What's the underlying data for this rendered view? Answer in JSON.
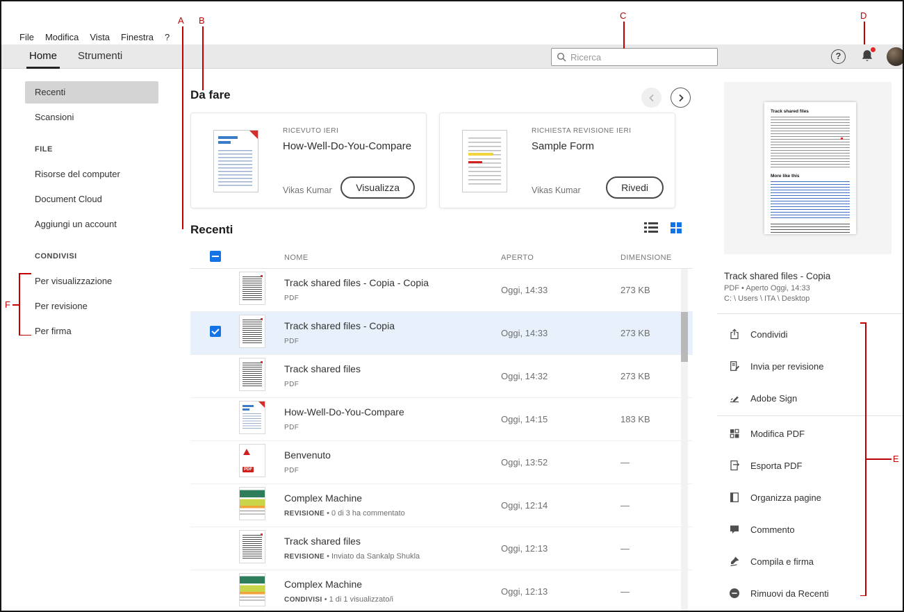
{
  "colors": {
    "accent_blue": "#1473E6",
    "annotation_red": "#C00000",
    "selected_row_bg": "#E8F1FB",
    "notification_dot": "#E5252A"
  },
  "menu": {
    "items": [
      "File",
      "Modifica",
      "Vista",
      "Finestra",
      "?"
    ]
  },
  "tabs": [
    "Home",
    "Strumenti"
  ],
  "header": {
    "search_placeholder": "Ricerca",
    "help_glyph": "?"
  },
  "sidebar": {
    "top_items": [
      "Recenti",
      "Scansioni"
    ],
    "sections": [
      {
        "title": "FILE",
        "items": [
          "Risorse del computer",
          "Document Cloud",
          "Aggiungi un account"
        ]
      },
      {
        "title": "CONDIVISI",
        "items": [
          "Per visualizzazione",
          "Per revisione",
          "Per firma"
        ]
      }
    ]
  },
  "todo": {
    "title": "Da fare",
    "cards": [
      {
        "tag": "RICEVUTO IERI",
        "title": "How-Well-Do-You-Compare",
        "owner": "Vikas Kumar",
        "button": "Visualizza"
      },
      {
        "tag": "RICHIESTA REVISIONE IERI",
        "title": "Sample Form",
        "owner": "Vikas Kumar",
        "button": "Rivedi"
      }
    ]
  },
  "recent": {
    "title": "Recenti",
    "columns": {
      "name": "NOME",
      "opened": "APERTO",
      "size": "DIMENSIONE"
    },
    "rows": [
      {
        "name": "Track shared files - Copia - Copia",
        "badge": "PDF",
        "detail": "",
        "opened": "Oggi, 14:33",
        "size": "273 KB"
      },
      {
        "name": "Track shared files - Copia",
        "badge": "PDF",
        "detail": "",
        "opened": "Oggi, 14:33",
        "size": "273 KB"
      },
      {
        "name": "Track shared files",
        "badge": "PDF",
        "detail": "",
        "opened": "Oggi, 14:32",
        "size": "273 KB"
      },
      {
        "name": "How-Well-Do-You-Compare",
        "badge": "PDF",
        "detail": "",
        "opened": "Oggi, 14:15",
        "size": "183 KB"
      },
      {
        "name": "Benvenuto",
        "badge": "PDF",
        "detail": "",
        "opened": "Oggi, 13:52",
        "size": "—"
      },
      {
        "name": "Complex Machine",
        "badge": "REVISIONE",
        "detail": "•  0 di 3 ha commentato",
        "opened": "Oggi, 12:14",
        "size": "—"
      },
      {
        "name": "Track shared files",
        "badge": "REVISIONE",
        "detail": "•  Inviato da Sankalp Shukla",
        "opened": "Oggi, 12:13",
        "size": "—"
      },
      {
        "name": "Complex Machine",
        "badge": "CONDIVISI",
        "detail": "•  1 di 1 visualizzato/i",
        "opened": "Oggi, 12:13",
        "size": "—"
      }
    ]
  },
  "detail": {
    "preview_title": "Track shared files",
    "preview_more": "More like this",
    "file_name": "Track shared files - Copia",
    "file_meta": "PDF  •  Aperto Oggi, 14:33",
    "file_path": "C: \\ Users \\ ITA \\ Desktop",
    "actions": [
      "Condividi",
      "Invia per revisione",
      "Adobe Sign",
      "Modifica PDF",
      "Esporta PDF",
      "Organizza pagine",
      "Commento",
      "Compila e firma",
      "Rimuovi da Recenti"
    ]
  },
  "annotations": [
    "A",
    "B",
    "C",
    "D",
    "E",
    "F"
  ]
}
